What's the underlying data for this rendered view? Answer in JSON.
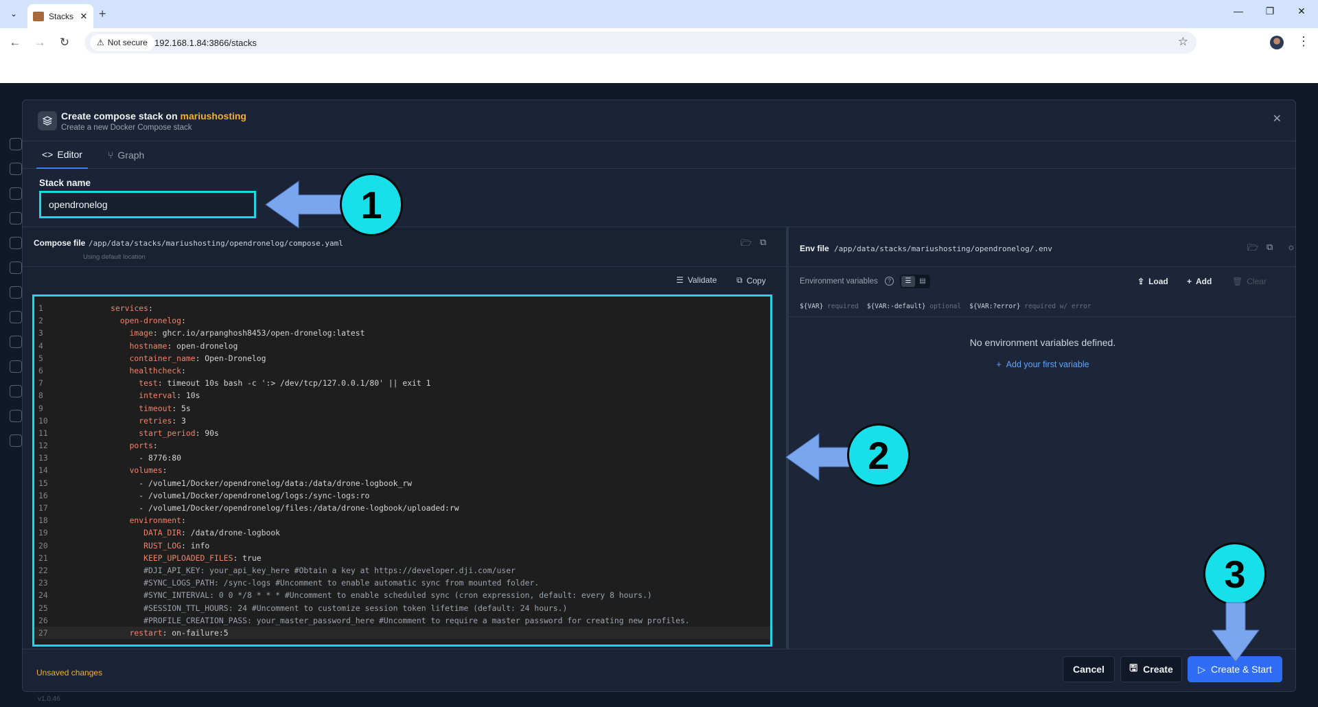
{
  "browser": {
    "tab_title": "Stacks",
    "tab_close": "✕",
    "new_tab": "+",
    "not_secure": "Not secure",
    "url": "192.168.1.84:3866/stacks",
    "minimize": "—",
    "restore": "❐",
    "close": "✕"
  },
  "app": {
    "version": "v1.0.46"
  },
  "modal": {
    "title_prefix": "Create compose stack on ",
    "host": "mariushosting",
    "subtitle": "Create a new Docker Compose stack",
    "close": "✕",
    "tabs": [
      {
        "label": "Editor",
        "icon": "code-icon"
      },
      {
        "label": "Graph",
        "icon": "graph-icon"
      }
    ],
    "stack_name_label": "Stack name",
    "stack_name_value": "opendronelog"
  },
  "compose": {
    "label": "Compose file",
    "path": "/app/data/stacks/mariushosting/opendronelog/compose.yaml",
    "hint": "Using default location",
    "validate": "Validate",
    "copy": "Copy",
    "lines": [
      {
        "n": "1",
        "indent": "      ",
        "key": "services",
        "rest": ":"
      },
      {
        "n": "2",
        "indent": "        ",
        "key": "open-dronelog",
        "rest": ":"
      },
      {
        "n": "3",
        "indent": "          ",
        "key": "image",
        "rest": ": ghcr.io/arpanghosh8453/open-dronelog:latest"
      },
      {
        "n": "4",
        "indent": "          ",
        "key": "hostname",
        "rest": ": open-dronelog"
      },
      {
        "n": "5",
        "indent": "          ",
        "key": "container_name",
        "rest": ": Open-Dronelog"
      },
      {
        "n": "6",
        "indent": "          ",
        "key": "healthcheck",
        "rest": ":"
      },
      {
        "n": "7",
        "indent": "            ",
        "key": "test",
        "rest": ": timeout 10s bash -c ':> /dev/tcp/127.0.0.1/80' || exit 1"
      },
      {
        "n": "8",
        "indent": "            ",
        "key": "interval",
        "rest": ": 10s"
      },
      {
        "n": "9",
        "indent": "            ",
        "key": "timeout",
        "rest": ": 5s"
      },
      {
        "n": "10",
        "indent": "            ",
        "key": "retries",
        "rest": ": 3"
      },
      {
        "n": "11",
        "indent": "            ",
        "key": "start_period",
        "rest": ": 90s"
      },
      {
        "n": "12",
        "indent": "          ",
        "key": "ports",
        "rest": ":"
      },
      {
        "n": "13",
        "indent": "            ",
        "key": "",
        "rest": "- 8776:80"
      },
      {
        "n": "14",
        "indent": "          ",
        "key": "volumes",
        "rest": ":"
      },
      {
        "n": "15",
        "indent": "            ",
        "key": "",
        "rest": "- /volume1/Docker/opendronelog/data:/data/drone-logbook_rw"
      },
      {
        "n": "16",
        "indent": "            ",
        "key": "",
        "rest": "- /volume1/Docker/opendronelog/logs:/sync-logs:ro"
      },
      {
        "n": "17",
        "indent": "            ",
        "key": "",
        "rest": "- /volume1/Docker/opendronelog/files:/data/drone-logbook/uploaded:rw"
      },
      {
        "n": "18",
        "indent": "          ",
        "key": "environment",
        "rest": ":"
      },
      {
        "n": "19",
        "indent": "             ",
        "key": "DATA_DIR",
        "rest": ": /data/drone-logbook"
      },
      {
        "n": "20",
        "indent": "             ",
        "key": "RUST_LOG",
        "rest": ": info"
      },
      {
        "n": "21",
        "indent": "             ",
        "key": "KEEP_UPLOADED_FILES",
        "rest": ": true"
      },
      {
        "n": "22",
        "indent": "             ",
        "comment": "#DJI_API_KEY: your_api_key_here #Obtain a key at https://developer.dji.com/user"
      },
      {
        "n": "23",
        "indent": "             ",
        "comment": "#SYNC_LOGS_PATH: /sync-logs #Uncomment to enable automatic sync from mounted folder."
      },
      {
        "n": "24",
        "indent": "             ",
        "comment": "#SYNC_INTERVAL: 0 0 */8 * * * #Uncomment to enable scheduled sync (cron expression, default: every 8 hours.)"
      },
      {
        "n": "25",
        "indent": "             ",
        "comment": "#SESSION_TTL_HOURS: 24 #Uncomment to customize session token lifetime (default: 24 hours.)"
      },
      {
        "n": "26",
        "indent": "             ",
        "comment": "#PROFILE_CREATION_PASS: your_master_password_here #Uncomment to require a master password for creating new profiles."
      },
      {
        "n": "27",
        "indent": "          ",
        "key": "restart",
        "rest": ": on-failure:5"
      }
    ]
  },
  "env": {
    "label": "Env file",
    "path": "/app/data/stacks/mariushosting/opendronelog/.env",
    "vars_title": "Environment variables",
    "help": "?",
    "load": "Load",
    "add": "Add",
    "clear": "Clear",
    "syntax": [
      {
        "code": "${VAR}",
        "desc": "required"
      },
      {
        "code": "${VAR:-default}",
        "desc": "optional"
      },
      {
        "code": "${VAR:?error}",
        "desc": "required w/ error"
      }
    ],
    "empty": "No environment variables defined.",
    "add_first": "Add your first variable"
  },
  "footer": {
    "unsaved": "Unsaved changes",
    "cancel": "Cancel",
    "create": "Create",
    "create_start": "Create & Start"
  },
  "callouts": [
    "1",
    "2",
    "3"
  ],
  "colors": {
    "highlight": "#1ad8e6",
    "callout_fill": "#18e0ea",
    "arrow_fill": "#7aa6f0",
    "accent": "#2f6df6",
    "host": "#f5b02e"
  }
}
